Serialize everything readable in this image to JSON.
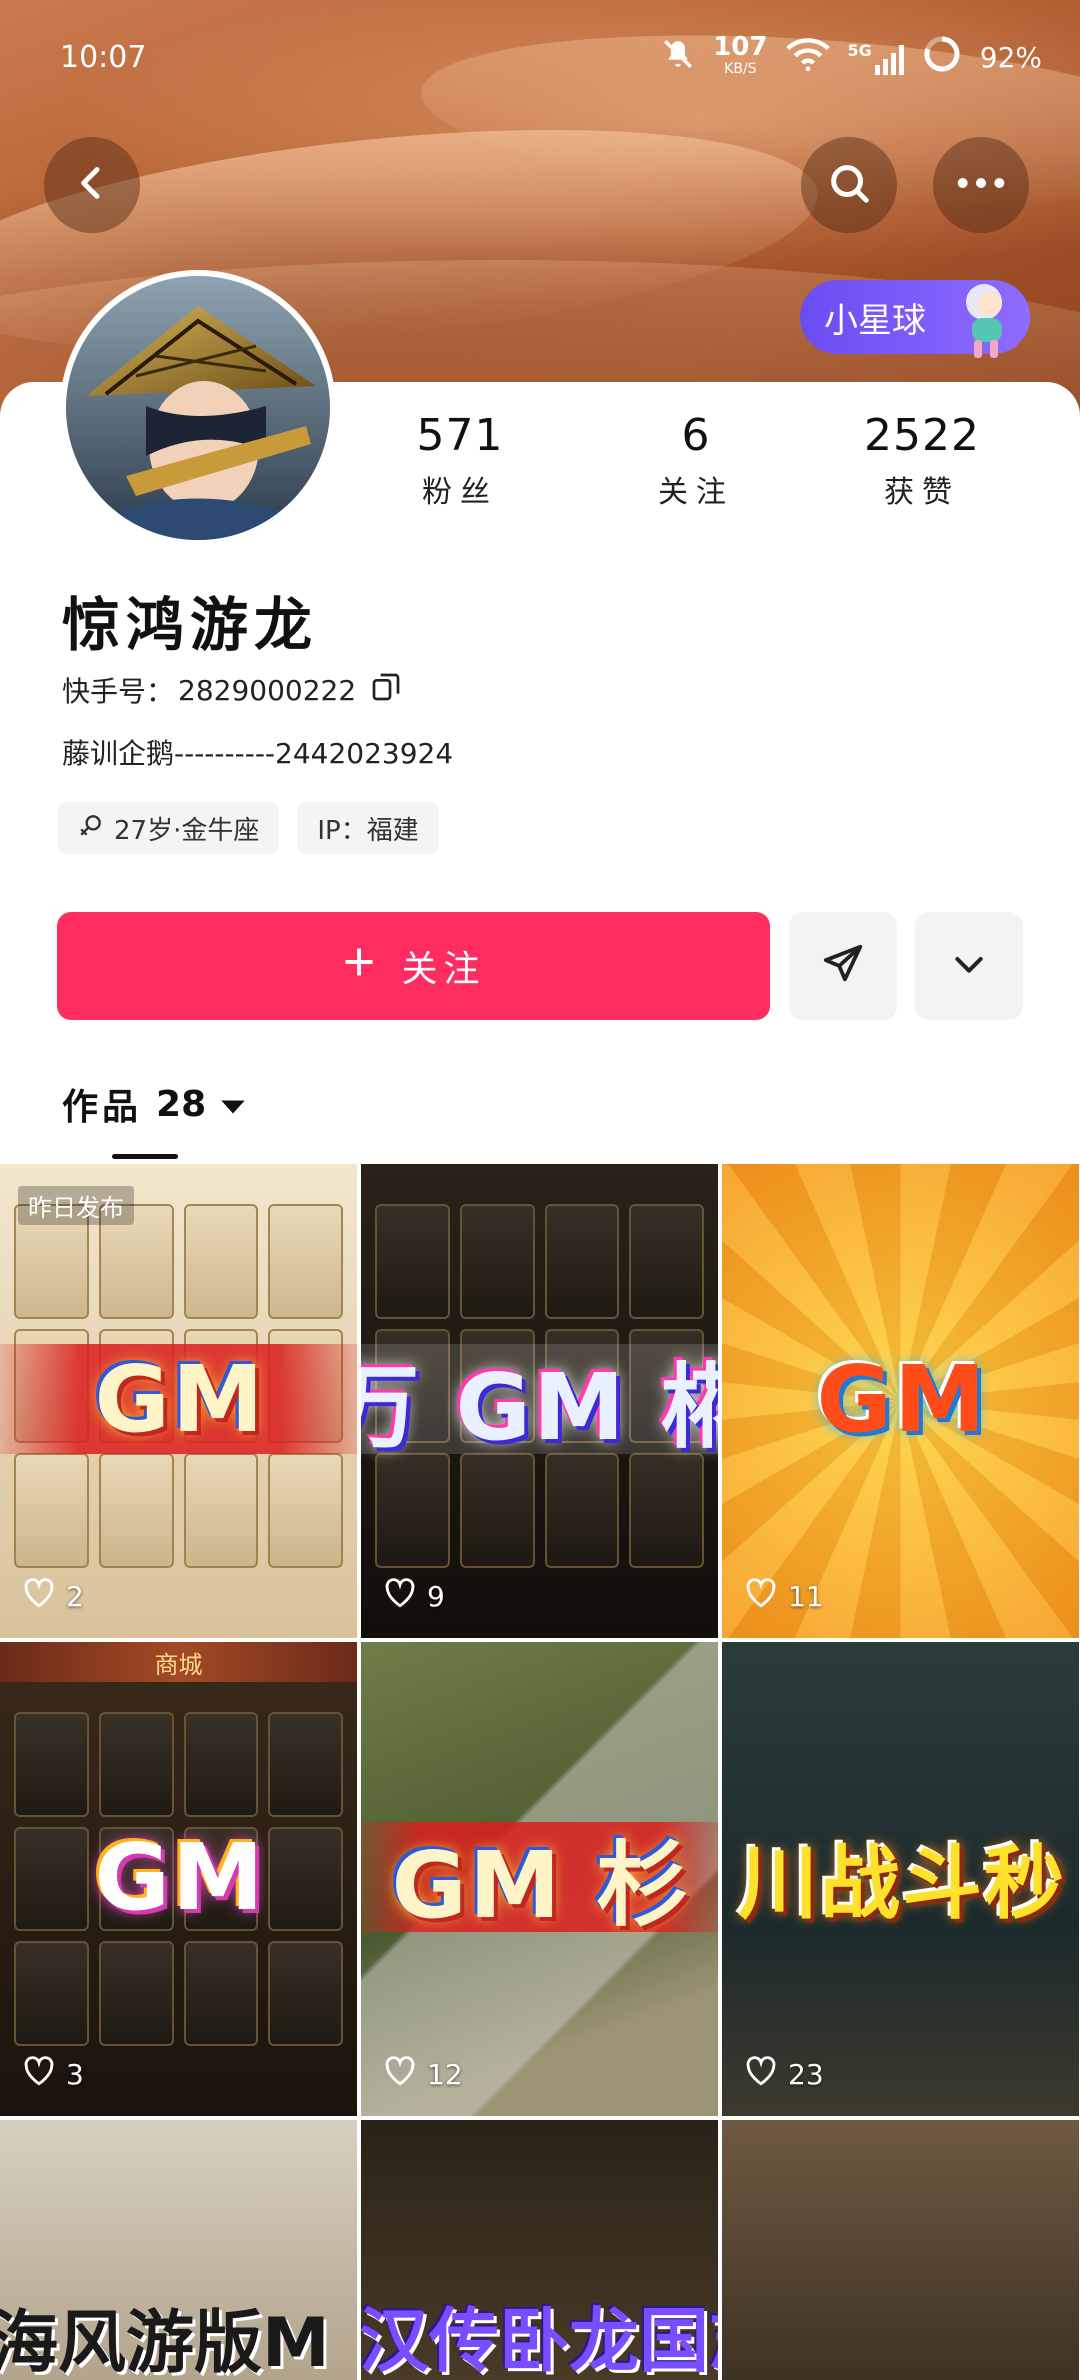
{
  "status_bar": {
    "time": "10:07",
    "speed_value": "107",
    "speed_unit": "KB/S",
    "network": "5G",
    "battery": "92%"
  },
  "header": {
    "back_icon": "chevron-left-icon",
    "search_icon": "search-icon",
    "more_icon": "more-horizontal-icon",
    "planet_badge": "小星球"
  },
  "profile": {
    "stats": [
      {
        "value": "571",
        "label": "粉丝"
      },
      {
        "value": "6",
        "label": "关注"
      },
      {
        "value": "2522",
        "label": "获赞"
      }
    ],
    "name": "惊鸿游龙",
    "kuaishou_id_label": "快手号：",
    "kuaishou_id": "2829000222",
    "bio": "藤训企鹅----------2442023924",
    "tags": [
      {
        "icon": "gender-icon",
        "text": "27岁·金牛座"
      },
      {
        "text": "IP：福建"
      }
    ]
  },
  "actions": {
    "follow_label": "关注",
    "share_icon": "send-icon",
    "expand_icon": "chevron-down-icon"
  },
  "tabs": {
    "works_label": "作品",
    "works_count": "28"
  },
  "videos": [
    {
      "likes": "2",
      "tag": "昨日发布",
      "banner": "GM",
      "theme": "light"
    },
    {
      "likes": "9",
      "banner": "万 GM 椛",
      "theme": "dark"
    },
    {
      "likes": "11",
      "banner": "GM",
      "theme": "burst"
    },
    {
      "likes": "3",
      "banner": "GM",
      "theme": "shop",
      "shop_title": "商城"
    },
    {
      "likes": "12",
      "banner": "GM 杉",
      "theme": "map"
    },
    {
      "likes": "23",
      "banner": "川战斗秒",
      "theme": "battle"
    },
    {
      "banner": "海风游版M",
      "theme": "room"
    },
    {
      "banner": "汉传卧龙国志吕布",
      "theme": "room2"
    },
    {
      "banner": "",
      "theme": "room3"
    }
  ],
  "colors": {
    "follow": "#fe2c5f",
    "planet": "#6a4df2"
  }
}
